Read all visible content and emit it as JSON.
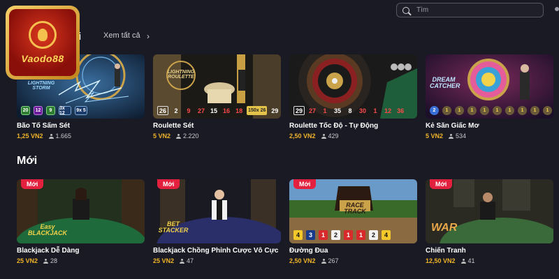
{
  "header": {
    "title_fragment": "",
    "search_placeholder": "Tìm"
  },
  "logo": {
    "text": "Vaodo88"
  },
  "section_popular": {
    "title_tail": "i",
    "see_all": "Xem tất cả",
    "chevron": "›"
  },
  "section_new": {
    "title": "Mới"
  },
  "badge_new": "Mới",
  "popular_games": [
    {
      "title": "Bão Tố Sấm Sét",
      "price": "1,25 VN2",
      "players": "1.665",
      "scene_label": "LIGHTNING STORM",
      "results": [
        "20",
        "12",
        "9",
        "3x 12",
        "9x 5"
      ]
    },
    {
      "title": "Roulette Sét",
      "price": "5 VN2",
      "players": "2.220",
      "scene_label": "LIGHTNING ROULETTE",
      "results": [
        "26",
        "2",
        "9",
        "27",
        "15",
        "16",
        "18",
        "150x 26",
        "29"
      ]
    },
    {
      "title": "Roulette Tốc Độ - Tự Động",
      "price": "2,50 VN2",
      "players": "429",
      "results": [
        "29",
        "27",
        "1",
        "35",
        "8",
        "30",
        "1",
        "12",
        "36"
      ]
    },
    {
      "title": "Kẻ Săn Giấc Mơ",
      "price": "5 VN2",
      "players": "534",
      "scene_label": "DREAM CATCHER",
      "results": [
        "2",
        "1",
        "1",
        "1",
        "1",
        "1",
        "1",
        "1",
        "1",
        "1"
      ]
    }
  ],
  "new_games": [
    {
      "title": "Blackjack Dễ Dàng",
      "price": "25 VN2",
      "players": "28",
      "scene_label": "Easy BLACKJACK"
    },
    {
      "title": "Blackjack Chồng Phỉnh Cược Vô Cực",
      "price": "25 VN2",
      "players": "47",
      "scene_label": "BET STACKER"
    },
    {
      "title": "Đường Đua",
      "price": "2,50 VN2",
      "players": "267",
      "scene_label": "RACE TRACK",
      "results": [
        "4",
        "3",
        "1",
        "2",
        "1",
        "1",
        "2",
        "4"
      ]
    },
    {
      "title": "Chiến Tranh",
      "price": "12,50 VN2",
      "players": "41",
      "scene_label": "WAR"
    }
  ],
  "colors": {
    "background": "#1a1a24",
    "price": "#f0b429",
    "badge": "#e4203f",
    "red_number": "#ff4a4a",
    "gold_result": "#e4c34b"
  }
}
